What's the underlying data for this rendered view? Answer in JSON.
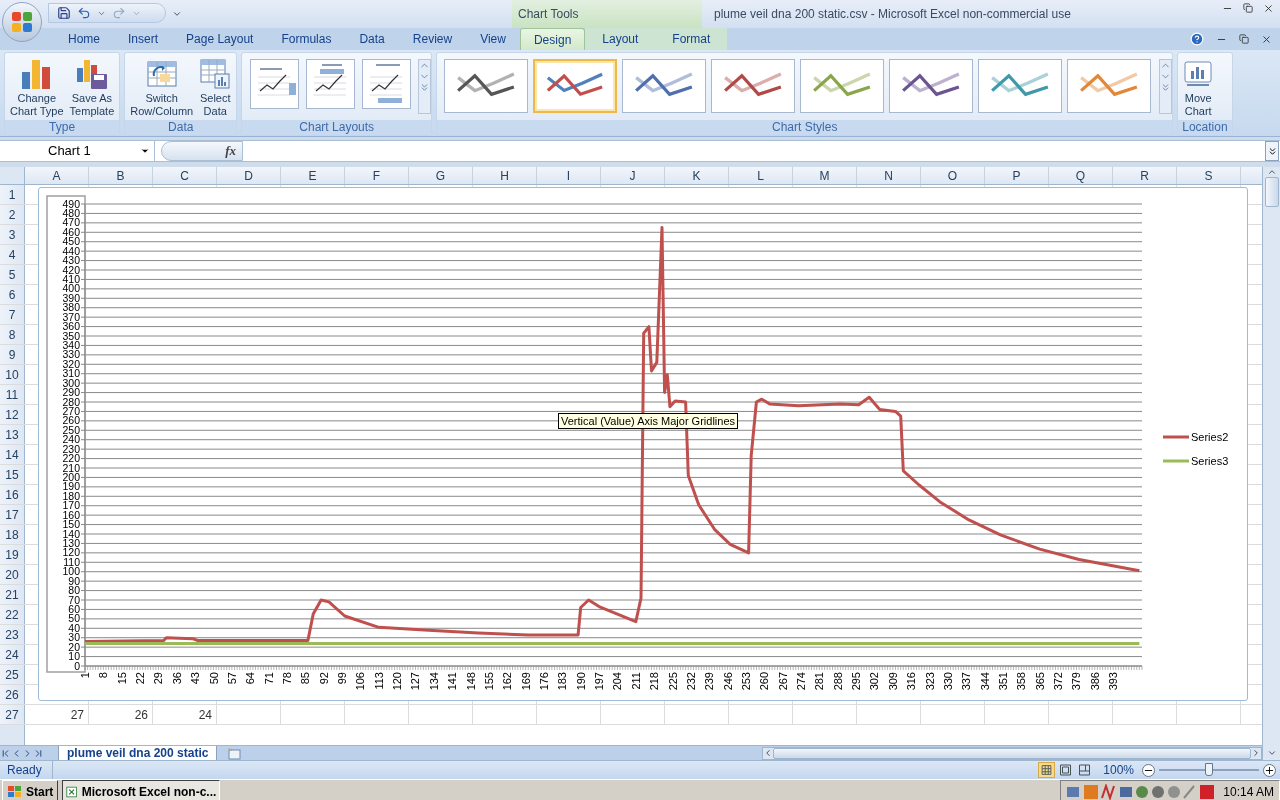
{
  "window": {
    "title": "plume veil dna 200 static.csv - Microsoft Excel non-commercial use",
    "context_title": "Chart Tools"
  },
  "ribbon_tabs": [
    {
      "label": "Home",
      "selected": false,
      "kind": "main"
    },
    {
      "label": "Insert",
      "selected": false,
      "kind": "main"
    },
    {
      "label": "Page Layout",
      "selected": false,
      "kind": "main"
    },
    {
      "label": "Formulas",
      "selected": false,
      "kind": "main"
    },
    {
      "label": "Data",
      "selected": false,
      "kind": "main"
    },
    {
      "label": "Review",
      "selected": false,
      "kind": "main"
    },
    {
      "label": "View",
      "selected": false,
      "kind": "main"
    },
    {
      "label": "Design",
      "selected": true,
      "kind": "context"
    },
    {
      "label": "Layout",
      "selected": false,
      "kind": "context"
    },
    {
      "label": "Format",
      "selected": false,
      "kind": "context"
    }
  ],
  "ribbon_groups": [
    {
      "label": "Type",
      "kind": "buttons",
      "buttons": [
        {
          "lines": [
            "Change",
            "Chart Type"
          ]
        },
        {
          "lines": [
            "Save As",
            "Template"
          ]
        }
      ]
    },
    {
      "label": "Data",
      "kind": "buttons",
      "buttons": [
        {
          "lines": [
            "Switch",
            "Row/Column"
          ]
        },
        {
          "lines": [
            "Select",
            "Data"
          ]
        }
      ]
    },
    {
      "label": "Chart Layouts",
      "kind": "layouts",
      "layouts": [
        {
          "kind": "legend-right"
        },
        {
          "kind": "labels-top"
        },
        {
          "kind": "labels-bottom"
        }
      ]
    },
    {
      "label": "Chart Styles",
      "kind": "styles",
      "styles": [
        {
          "kind": "single",
          "color": "#555555",
          "selected": false
        },
        {
          "kind": "multi",
          "color": "#c0504d",
          "selected": true
        },
        {
          "kind": "single",
          "color": "#4f6fae",
          "selected": false
        },
        {
          "kind": "single",
          "color": "#b04a48",
          "selected": false
        },
        {
          "kind": "single",
          "color": "#8aa54a",
          "selected": false
        },
        {
          "kind": "single",
          "color": "#6a5590",
          "selected": false
        },
        {
          "kind": "single",
          "color": "#3f99a8",
          "selected": false
        },
        {
          "kind": "single",
          "color": "#e0883a",
          "selected": false
        }
      ]
    },
    {
      "label": "Location",
      "kind": "buttons",
      "buttons": [
        {
          "lines": [
            "Move",
            "Chart"
          ]
        }
      ]
    }
  ],
  "formula_bar": {
    "name_box": "Chart 1",
    "function_label": "fx"
  },
  "columns": [
    "A",
    "B",
    "C",
    "D",
    "E",
    "F",
    "G",
    "H",
    "I",
    "J",
    "K",
    "L",
    "M",
    "N",
    "O",
    "P",
    "Q",
    "R",
    "S"
  ],
  "rows": [
    {
      "header": "1"
    },
    {
      "header": "2"
    },
    {
      "header": "3"
    },
    {
      "header": "4"
    },
    {
      "header": "5"
    },
    {
      "header": "6"
    },
    {
      "header": "7"
    },
    {
      "header": "8"
    },
    {
      "header": "9"
    },
    {
      "header": "10"
    },
    {
      "header": "11"
    },
    {
      "header": "12"
    },
    {
      "header": "13"
    },
    {
      "header": "14"
    },
    {
      "header": "15"
    },
    {
      "header": "16"
    },
    {
      "header": "17"
    },
    {
      "header": "18"
    },
    {
      "header": "19"
    },
    {
      "header": "20"
    },
    {
      "header": "21"
    },
    {
      "header": "22"
    },
    {
      "header": "23"
    },
    {
      "header": "24"
    },
    {
      "header": "25"
    },
    {
      "header": "26"
    },
    {
      "header": "27",
      "cells": [
        "27",
        "26",
        "24"
      ]
    }
  ],
  "chart": {
    "tooltip": "Vertical (Value) Axis Major Gridlines",
    "chart_data": {
      "type": "line",
      "x": [
        1,
        31,
        32,
        42,
        44,
        86,
        88,
        91,
        94,
        100,
        113,
        132,
        151,
        170,
        189,
        190,
        193,
        197,
        211,
        213,
        214,
        216,
        217,
        219,
        221,
        222,
        223,
        224,
        226,
        230,
        231,
        235,
        241,
        247,
        254,
        255,
        257,
        259,
        262,
        273,
        289,
        296,
        300,
        304,
        310,
        312,
        313,
        319,
        327,
        338,
        350,
        365,
        380,
        403
      ],
      "series": [
        {
          "name": "Series2",
          "color": "#c0504d",
          "values": [
            26,
            27,
            30,
            29,
            27,
            27,
            55,
            70,
            68,
            53,
            41,
            38,
            35,
            33,
            33,
            62,
            70,
            63,
            47,
            72,
            353,
            360,
            313,
            322,
            465,
            290,
            309,
            275,
            281,
            280,
            202,
            171,
            145,
            129,
            120,
            223,
            280,
            283,
            278,
            276,
            278,
            277,
            285,
            272,
            270,
            265,
            207,
            192,
            174,
            155,
            139,
            124,
            113,
            101
          ]
        },
        {
          "name": "Series3",
          "color": "#9bbb59",
          "values": [
            24,
            24,
            24,
            24,
            24,
            24,
            24,
            24,
            24,
            24,
            24,
            24,
            24,
            24,
            24,
            24,
            24,
            24,
            24,
            24,
            24,
            24,
            24,
            24,
            24,
            24,
            24,
            24,
            24,
            24,
            24,
            24,
            24,
            24,
            24,
            24,
            24,
            24,
            24,
            24,
            24,
            24,
            24,
            24,
            24,
            24,
            24,
            24,
            24,
            24,
            24,
            24,
            24,
            24
          ]
        }
      ],
      "xlim": [
        1,
        404
      ],
      "ylim": [
        0,
        490
      ],
      "grid": {
        "y": true
      },
      "legend": true,
      "xticks": [
        1,
        8,
        15,
        22,
        29,
        36,
        43,
        50,
        57,
        64,
        71,
        78,
        85,
        92,
        99,
        106,
        113,
        120,
        127,
        134,
        141,
        148,
        155,
        162,
        169,
        176,
        183,
        190,
        197,
        204,
        211,
        218,
        225,
        232,
        239,
        246,
        253,
        260,
        267,
        274,
        281,
        288,
        295,
        302,
        309,
        316,
        323,
        330,
        337,
        344,
        351,
        358,
        365,
        372,
        379,
        386,
        393
      ],
      "yticks": [
        0,
        10,
        20,
        30,
        40,
        50,
        60,
        70,
        80,
        90,
        100,
        110,
        120,
        130,
        140,
        150,
        160,
        170,
        180,
        190,
        200,
        210,
        220,
        230,
        240,
        250,
        260,
        270,
        280,
        290,
        300,
        310,
        320,
        330,
        340,
        350,
        360,
        370,
        380,
        390,
        400,
        410,
        420,
        430,
        440,
        450,
        460,
        470,
        480,
        490
      ]
    }
  },
  "sheet_tabs": [
    {
      "label": "plume veil dna 200 static",
      "selected": true
    }
  ],
  "status_bar": {
    "text": "Ready",
    "views": [
      {
        "kind": "normal",
        "selected": true
      },
      {
        "kind": "page-layout",
        "selected": false
      },
      {
        "kind": "page-break",
        "selected": false
      }
    ],
    "zoom": "100%",
    "level": 0.5
  },
  "taskbar": {
    "start": "Start",
    "tasks": [
      {
        "label": "Microsoft Excel non-c...",
        "selected": true
      }
    ],
    "clock": "10:14 AM"
  }
}
